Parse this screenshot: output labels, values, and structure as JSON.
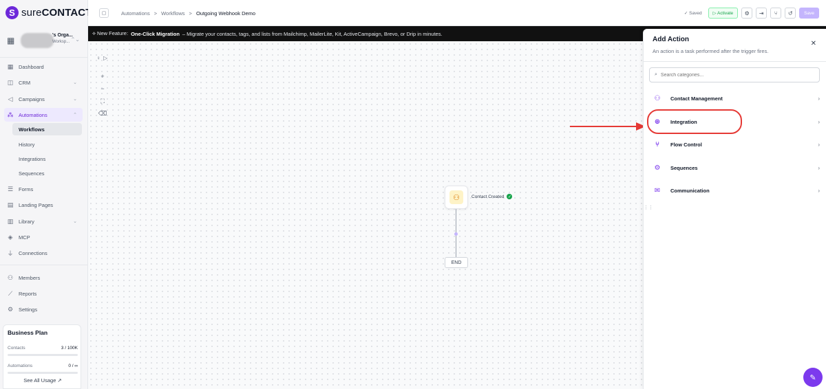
{
  "brand": {
    "mark": "S",
    "name_light": "sure",
    "name_bold": "CONTACT"
  },
  "org": {
    "name": "'s Orga...",
    "sub": "Worksp..."
  },
  "nav": {
    "dashboard": "Dashboard",
    "crm": "CRM",
    "campaigns": "Campaigns",
    "automations": "Automations",
    "workflows": "Workflows",
    "history": "History",
    "integrations": "Integrations",
    "sequences": "Sequences",
    "forms": "Forms",
    "landing_pages": "Landing Pages",
    "library": "Library",
    "mcp": "MCP",
    "connections": "Connections",
    "members": "Members",
    "reports": "Reports",
    "settings": "Settings"
  },
  "plan": {
    "title": "Business Plan",
    "contacts_label": "Contacts",
    "contacts_value": "3 / 100K",
    "automations_label": "Automations",
    "automations_value": "0 / ∞",
    "link": "See All Usage ↗"
  },
  "breadcrumb": {
    "a": "Automations",
    "b": "Workflows",
    "c": "Outgoing Webhook Demo",
    "sep": ">"
  },
  "toolbar": {
    "saved": "✓ Saved",
    "activate": "▷ Activate",
    "save": "Save"
  },
  "banner": {
    "prefix": "⟡ New Feature:",
    "bold": "One-Click Migration",
    "rest": "– Migrate your contacts, tags, and lists from Mailchimp, MailerLite, Kit, ActiveCampaign, Brevo, or Drip in minutes."
  },
  "canvas": {
    "trigger_label": "Contact Created",
    "end_label": "END"
  },
  "drawer": {
    "title": "Add Action",
    "subtitle": "An action is a task performed after the trigger fires.",
    "search_placeholder": "Search categories...",
    "categories": [
      {
        "label": "Contact Management",
        "icon": "user-plus-icon"
      },
      {
        "label": "Integration",
        "icon": "globe-icon"
      },
      {
        "label": "Flow Control",
        "icon": "branch-icon"
      },
      {
        "label": "Sequences",
        "icon": "gear-icon"
      },
      {
        "label": "Communication",
        "icon": "mail-icon"
      }
    ]
  },
  "colors": {
    "accent": "#7c3aed",
    "highlight": "#e53935",
    "success": "#16a34a"
  }
}
